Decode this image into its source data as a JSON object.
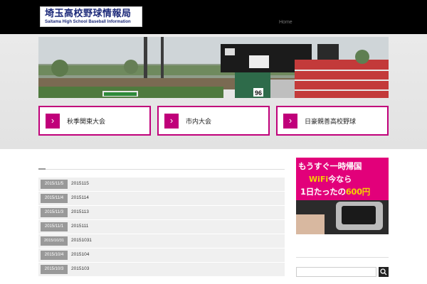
{
  "header": {
    "logo_title": "埼玉高校野球情報局",
    "logo_subtitle": "Saitama High School Baseball Information",
    "nav_home": "Home"
  },
  "hero": {
    "scoreboard_number": "96"
  },
  "promos": [
    {
      "label": "秋季関東大会"
    },
    {
      "label": "市内大会"
    },
    {
      "label": "日豪親善高校野球"
    }
  ],
  "posts": [
    {
      "date": "2015/11/5",
      "title": "2015115"
    },
    {
      "date": "2015/11/4",
      "title": "2015114"
    },
    {
      "date": "2015/11/3",
      "title": "2015113"
    },
    {
      "date": "2015/11/1",
      "title": "2015111"
    },
    {
      "date": "2015/10/31",
      "title": "20151031"
    },
    {
      "date": "2015/10/4",
      "title": "2015104"
    },
    {
      "date": "2015/10/3",
      "title": "2015103"
    }
  ],
  "ad": {
    "line1": "もうすぐ一時帰国",
    "wifi": "WiFi",
    "line2": "今なら",
    "line3a": "1日たったの",
    "line3b": "600円"
  },
  "colors": {
    "accent": "#c0007a",
    "header_bg": "#000000",
    "date_badge": "#999999"
  }
}
